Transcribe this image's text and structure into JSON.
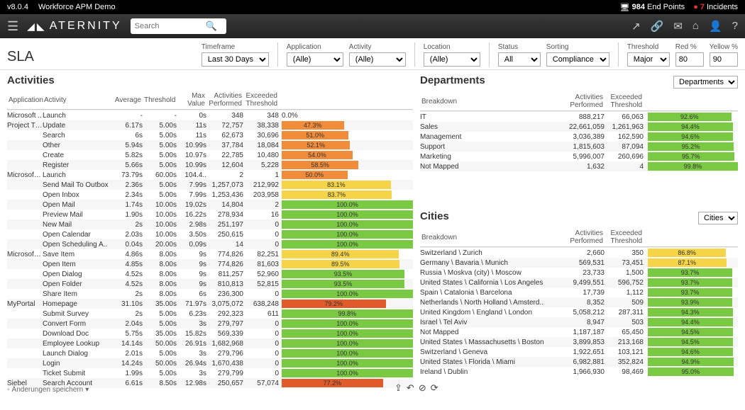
{
  "topbar": {
    "version": "v8.0.4",
    "appName": "Workforce APM Demo",
    "endpoints_icon": "🖥",
    "endpoints_count": "984",
    "endpoints_label": "End Points",
    "incidents_icon": "●",
    "incidents_count": "7",
    "incidents_label": "Incidents"
  },
  "nav": {
    "logo": "ATERNITY",
    "search_placeholder": "Search"
  },
  "filters": {
    "timeframe_label": "Timeframe",
    "timeframe_value": "Last 30 Days",
    "application_label": "Application",
    "application_value": "(Alle)",
    "activity_label": "Activity",
    "activity_value": "(Alle)",
    "location_label": "Location",
    "location_value": "(Alle)",
    "status_label": "Status",
    "status_value": "All",
    "sorting_label": "Sorting",
    "sorting_value": "Compliance",
    "threshold_label": "Threshold",
    "threshold_value": "Major",
    "red_label": "Red %",
    "red_value": "80",
    "yellow_label": "Yellow %",
    "yellow_value": "90"
  },
  "page_title": "SLA",
  "activities": {
    "title": "Activities",
    "headers": {
      "app": "Application",
      "activity": "Activity",
      "average": "Average",
      "threshold": "Threshold",
      "max": "Max Value",
      "performed": "Activities Performed",
      "exceeded": "Exceeded Threshold"
    },
    "rows": [
      {
        "app": "Microsoft ..",
        "act": "Launch",
        "avg": "-",
        "thr": "-",
        "max": "0s",
        "perf": "348",
        "exc": "348",
        "pct": 0,
        "lbl": "0.0%",
        "cls": ""
      },
      {
        "app": "Project Tracker",
        "act": "Update",
        "avg": "6.17s",
        "thr": "5.00s",
        "max": "11s",
        "perf": "72,757",
        "exc": "38,338",
        "pct": 47.3,
        "lbl": "47.3%",
        "cls": "orange"
      },
      {
        "app": "",
        "act": "Search",
        "avg": "6s",
        "thr": "5.00s",
        "max": "11s",
        "perf": "62,673",
        "exc": "30,696",
        "pct": 51.0,
        "lbl": "51.0%",
        "cls": "orange"
      },
      {
        "app": "",
        "act": "Other",
        "avg": "5.94s",
        "thr": "5.00s",
        "max": "10.99s",
        "perf": "37,784",
        "exc": "18,084",
        "pct": 52.1,
        "lbl": "52.1%",
        "cls": "orange"
      },
      {
        "app": "",
        "act": "Create",
        "avg": "5.82s",
        "thr": "5.00s",
        "max": "10.97s",
        "perf": "22,785",
        "exc": "10,480",
        "pct": 54.0,
        "lbl": "54.0%",
        "cls": "orange"
      },
      {
        "app": "",
        "act": "Register",
        "avg": "5.66s",
        "thr": "5.00s",
        "max": "10.99s",
        "perf": "12,604",
        "exc": "5,228",
        "pct": 58.5,
        "lbl": "58.5%",
        "cls": "orange"
      },
      {
        "app": "Microsoft Outlook",
        "act": "Launch",
        "avg": "73.79s",
        "thr": "60.00s",
        "max": "104.4..",
        "perf": "2",
        "exc": "1",
        "pct": 50.0,
        "lbl": "50.0%",
        "cls": "orange"
      },
      {
        "app": "",
        "act": "Send Mail To Outbox",
        "avg": "2.36s",
        "thr": "5.00s",
        "max": "7.99s",
        "perf": "1,257,073",
        "exc": "212,992",
        "pct": 83.1,
        "lbl": "83.1%",
        "cls": "yellow"
      },
      {
        "app": "",
        "act": "Open Inbox",
        "avg": "2.34s",
        "thr": "5.00s",
        "max": "7.99s",
        "perf": "1,253,436",
        "exc": "203,958",
        "pct": 83.7,
        "lbl": "83.7%",
        "cls": "yellow"
      },
      {
        "app": "",
        "act": "Open Mail",
        "avg": "1.74s",
        "thr": "10.00s",
        "max": "19.02s",
        "perf": "14,804",
        "exc": "2",
        "pct": 100,
        "lbl": "100.0%",
        "cls": "green"
      },
      {
        "app": "",
        "act": "Preview Mail",
        "avg": "1.90s",
        "thr": "10.00s",
        "max": "16.22s",
        "perf": "278,934",
        "exc": "16",
        "pct": 100,
        "lbl": "100.0%",
        "cls": "green"
      },
      {
        "app": "",
        "act": "New Mail",
        "avg": "2s",
        "thr": "10.00s",
        "max": "2.98s",
        "perf": "251,197",
        "exc": "0",
        "pct": 100,
        "lbl": "100.0%",
        "cls": "green"
      },
      {
        "app": "",
        "act": "Open Calendar",
        "avg": "2.03s",
        "thr": "10.00s",
        "max": "3.50s",
        "perf": "250,615",
        "exc": "0",
        "pct": 100,
        "lbl": "100.0%",
        "cls": "green"
      },
      {
        "app": "",
        "act": "Open Scheduling A..",
        "avg": "0.04s",
        "thr": "20.00s",
        "max": "0.09s",
        "perf": "14",
        "exc": "0",
        "pct": 100,
        "lbl": "100.0%",
        "cls": "green"
      },
      {
        "app": "Microsoft SharePoint",
        "act": "Save Item",
        "avg": "4.86s",
        "thr": "8.00s",
        "max": "9s",
        "perf": "774,826",
        "exc": "82,251",
        "pct": 89.4,
        "lbl": "89.4%",
        "cls": "yellow"
      },
      {
        "app": "",
        "act": "Open Item",
        "avg": "4.85s",
        "thr": "8.00s",
        "max": "9s",
        "perf": "774,826",
        "exc": "81,603",
        "pct": 89.5,
        "lbl": "89.5%",
        "cls": "yellow"
      },
      {
        "app": "",
        "act": "Open Dialog",
        "avg": "4.52s",
        "thr": "8.00s",
        "max": "9s",
        "perf": "811,257",
        "exc": "52,960",
        "pct": 93.5,
        "lbl": "93.5%",
        "cls": "green"
      },
      {
        "app": "",
        "act": "Open Folder",
        "avg": "4.52s",
        "thr": "8.00s",
        "max": "9s",
        "perf": "810,813",
        "exc": "52,815",
        "pct": 93.5,
        "lbl": "93.5%",
        "cls": "green"
      },
      {
        "app": "",
        "act": "Share Item",
        "avg": "2s",
        "thr": "8.00s",
        "max": "6s",
        "perf": "236,300",
        "exc": "0",
        "pct": 100,
        "lbl": "100.0%",
        "cls": "green"
      },
      {
        "app": "MyPortal",
        "act": "Homepage",
        "avg": "31.10s",
        "thr": "35.00s",
        "max": "71.97s",
        "perf": "3,075,072",
        "exc": "638,248",
        "pct": 79.2,
        "lbl": "79.2%",
        "cls": "red"
      },
      {
        "app": "",
        "act": "Submit Survey",
        "avg": "2s",
        "thr": "5.00s",
        "max": "6.23s",
        "perf": "292,323",
        "exc": "611",
        "pct": 99.8,
        "lbl": "99.8%",
        "cls": "green"
      },
      {
        "app": "",
        "act": "Convert Form",
        "avg": "2.04s",
        "thr": "5.00s",
        "max": "3s",
        "perf": "279,797",
        "exc": "0",
        "pct": 100,
        "lbl": "100.0%",
        "cls": "green"
      },
      {
        "app": "",
        "act": "Download Doc",
        "avg": "5.75s",
        "thr": "35.00s",
        "max": "15.82s",
        "perf": "569,339",
        "exc": "0",
        "pct": 100,
        "lbl": "100.0%",
        "cls": "green"
      },
      {
        "app": "",
        "act": "Employee Lookup",
        "avg": "14.14s",
        "thr": "50.00s",
        "max": "26.91s",
        "perf": "1,682,968",
        "exc": "0",
        "pct": 100,
        "lbl": "100.0%",
        "cls": "green"
      },
      {
        "app": "",
        "act": "Launch Dialog",
        "avg": "2.01s",
        "thr": "5.00s",
        "max": "3s",
        "perf": "279,796",
        "exc": "0",
        "pct": 100,
        "lbl": "100.0%",
        "cls": "green"
      },
      {
        "app": "",
        "act": "Login",
        "avg": "14.24s",
        "thr": "50.00s",
        "max": "26.94s",
        "perf": "1,670,438",
        "exc": "0",
        "pct": 100,
        "lbl": "100.0%",
        "cls": "green"
      },
      {
        "app": "",
        "act": "Ticket Submit",
        "avg": "1.99s",
        "thr": "5.00s",
        "max": "3s",
        "perf": "279,799",
        "exc": "0",
        "pct": 100,
        "lbl": "100.0%",
        "cls": "green"
      },
      {
        "app": "Siebel",
        "act": "Search Account",
        "avg": "6.61s",
        "thr": "8.50s",
        "max": "12.98s",
        "perf": "250,657",
        "exc": "57,074",
        "pct": 77.2,
        "lbl": "77.2%",
        "cls": "red"
      }
    ]
  },
  "departments": {
    "title": "Departments",
    "select": "Departments",
    "headers": {
      "breakdown": "Breakdown",
      "performed": "Activities Performed",
      "exceeded": "Exceeded Threshold"
    },
    "rows": [
      {
        "name": "IT",
        "perf": "888,217",
        "exc": "66,063",
        "pct": 92.6,
        "lbl": "92.6%",
        "cls": "green"
      },
      {
        "name": "Sales",
        "perf": "22,661,059",
        "exc": "1,261,963",
        "pct": 94.4,
        "lbl": "94.4%",
        "cls": "green"
      },
      {
        "name": "Management",
        "perf": "3,036,389",
        "exc": "162,590",
        "pct": 94.6,
        "lbl": "94.6%",
        "cls": "green"
      },
      {
        "name": "Support",
        "perf": "1,815,603",
        "exc": "87,094",
        "pct": 95.2,
        "lbl": "95.2%",
        "cls": "green"
      },
      {
        "name": "Marketing",
        "perf": "5,996,007",
        "exc": "260,696",
        "pct": 95.7,
        "lbl": "95.7%",
        "cls": "green"
      },
      {
        "name": "Not Mapped",
        "perf": "1,632",
        "exc": "4",
        "pct": 99.8,
        "lbl": "99.8%",
        "cls": "green"
      }
    ]
  },
  "cities": {
    "title": "Cities",
    "select": "Cities",
    "headers": {
      "breakdown": "Breakdown",
      "performed": "Activities Performed",
      "exceeded": "Exceeded Threshold"
    },
    "rows": [
      {
        "name": "Switzerland \\ Zurich",
        "perf": "2,660",
        "exc": "350",
        "pct": 86.8,
        "lbl": "86.8%",
        "cls": "yellow"
      },
      {
        "name": "Germany \\ Bavaria \\ Munich",
        "perf": "569,531",
        "exc": "73,451",
        "pct": 87.1,
        "lbl": "87.1%",
        "cls": "yellow"
      },
      {
        "name": "Russia \\ Moskva (city) \\ Moscow",
        "perf": "23,733",
        "exc": "1,500",
        "pct": 93.7,
        "lbl": "93.7%",
        "cls": "green"
      },
      {
        "name": "United States \\ California \\ Los Angeles",
        "perf": "9,499,551",
        "exc": "596,752",
        "pct": 93.7,
        "lbl": "93.7%",
        "cls": "green"
      },
      {
        "name": "Spain \\ Catalonia \\ Barcelona",
        "perf": "17,739",
        "exc": "1,112",
        "pct": 93.7,
        "lbl": "93.7%",
        "cls": "green"
      },
      {
        "name": "Netherlands \\ North Holland \\ Amsterd..",
        "perf": "8,352",
        "exc": "509",
        "pct": 93.9,
        "lbl": "93.9%",
        "cls": "green"
      },
      {
        "name": "United Kingdom \\ England \\ London",
        "perf": "5,058,212",
        "exc": "287,311",
        "pct": 94.3,
        "lbl": "94.3%",
        "cls": "green"
      },
      {
        "name": "Israel \\ Tel Aviv",
        "perf": "8,947",
        "exc": "503",
        "pct": 94.4,
        "lbl": "94.4%",
        "cls": "green"
      },
      {
        "name": "Not Mapped",
        "perf": "1,187,187",
        "exc": "65,450",
        "pct": 94.5,
        "lbl": "94.5%",
        "cls": "green"
      },
      {
        "name": "United States \\ Massachusetts \\ Boston",
        "perf": "3,899,853",
        "exc": "213,168",
        "pct": 94.5,
        "lbl": "94.5%",
        "cls": "green"
      },
      {
        "name": "Switzerland \\ Geneva",
        "perf": "1,922,651",
        "exc": "103,121",
        "pct": 94.6,
        "lbl": "94.6%",
        "cls": "green"
      },
      {
        "name": "United States \\ Florida \\ Miami",
        "perf": "6,982,881",
        "exc": "352,824",
        "pct": 94.9,
        "lbl": "94.9%",
        "cls": "green"
      },
      {
        "name": "Ireland \\ Dublin",
        "perf": "1,966,930",
        "exc": "98,469",
        "pct": 95.0,
        "lbl": "95.0%",
        "cls": "green"
      }
    ]
  },
  "footer": {
    "text": "Änderungen speichern"
  }
}
